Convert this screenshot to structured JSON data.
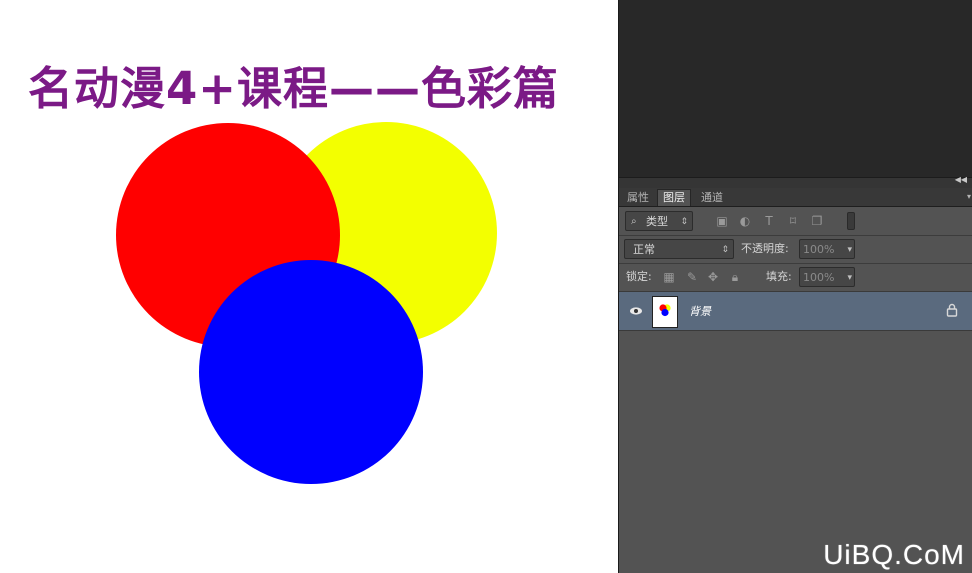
{
  "canvas": {
    "title": "名动漫4+课程——色彩篇",
    "title_color": "#7b1a86",
    "circles": [
      {
        "name": "yellow-circle",
        "color": "#f3ff00"
      },
      {
        "name": "red-circle",
        "color": "#ff0000"
      },
      {
        "name": "blue-circle",
        "color": "#0000ff"
      }
    ]
  },
  "panel": {
    "tabs": [
      {
        "label": "属性",
        "active": false
      },
      {
        "label": "图层",
        "active": true
      },
      {
        "label": "通道",
        "active": false
      }
    ],
    "filter": {
      "label": "类型"
    },
    "blend_mode": {
      "value": "正常"
    },
    "opacity": {
      "label": "不透明度:",
      "value": "100%"
    },
    "lock": {
      "label": "锁定:"
    },
    "fill": {
      "label": "填充:",
      "value": "100%"
    },
    "layers": [
      {
        "name": "背景",
        "visible": true,
        "locked": true,
        "selected": true
      }
    ]
  },
  "watermark": "UiBQ.CoM",
  "colors": {
    "panel_bg": "#535353",
    "selected_layer": "#5a6a7e",
    "dark_area": "#282828"
  }
}
